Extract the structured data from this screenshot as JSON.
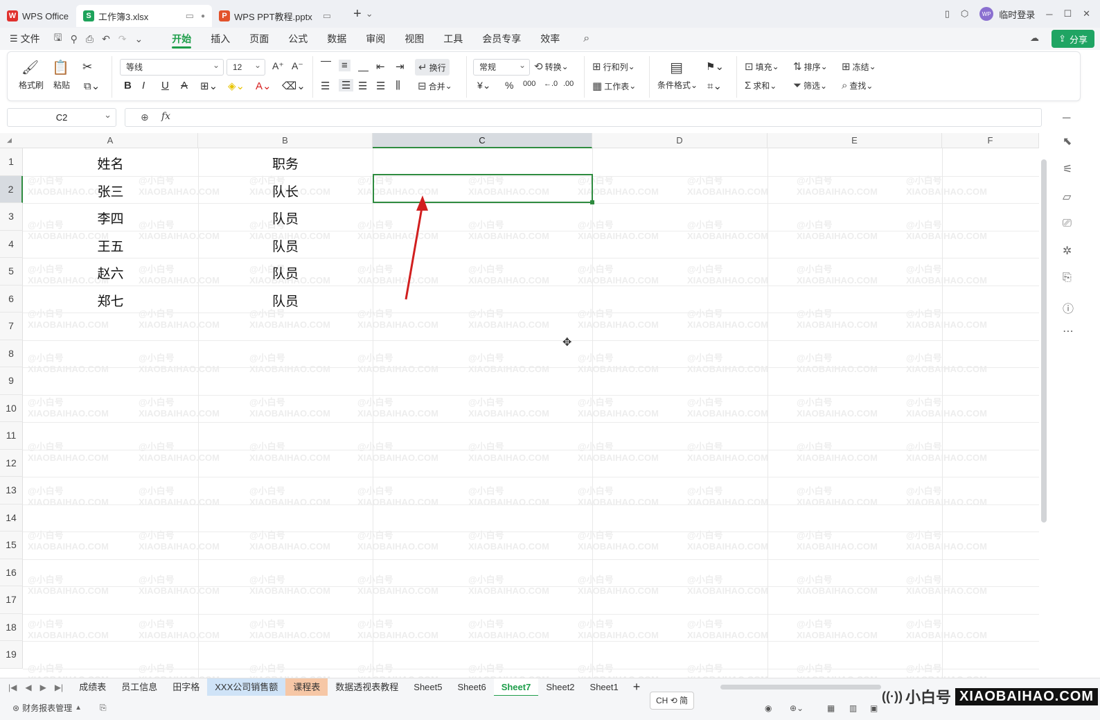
{
  "titlebar": {
    "tabs": [
      {
        "label": "WPS Office",
        "logo": "W",
        "color": "#e0312e"
      },
      {
        "label": "工作簿3.xlsx",
        "logo": "S",
        "color": "#1ea35b"
      },
      {
        "label": "WPS PPT教程.pptx",
        "logo": "P",
        "color": "#e2522b"
      }
    ],
    "login": "临时登录",
    "avatar": "WP"
  },
  "menubar": {
    "file": "文件",
    "items": [
      "开始",
      "插入",
      "页面",
      "公式",
      "数据",
      "审阅",
      "视图",
      "工具",
      "会员专享",
      "效率"
    ],
    "active": "开始",
    "share": "分享"
  },
  "ribbon": {
    "format_painter": "格式刷",
    "paste": "粘贴",
    "font": "等线",
    "size": "12",
    "wrap": "换行",
    "merge": "合并",
    "number_format": "常规",
    "convert": "转换",
    "rows_cols": "行和列",
    "worksheet": "工作表",
    "cond_format": "条件格式",
    "fill": "填充",
    "sort": "排序",
    "freeze": "冻结",
    "sum": "求和",
    "filter": "筛选",
    "find": "查找"
  },
  "formula": {
    "namebox": "C2",
    "fx": "fx",
    "value": ""
  },
  "columns": [
    "A",
    "B",
    "C",
    "D",
    "E",
    "F"
  ],
  "rows": [
    "1",
    "2",
    "3",
    "4",
    "5",
    "6",
    "7",
    "8",
    "9",
    "10",
    "11",
    "12",
    "13",
    "14",
    "15",
    "16",
    "17",
    "18",
    "19"
  ],
  "cells": {
    "A": [
      "姓名",
      "张三",
      "李四",
      "王五",
      "赵六",
      "郑七"
    ],
    "B": [
      "职务",
      "队长",
      "队员",
      "队员",
      "队员",
      "队员"
    ]
  },
  "watermark": {
    "line1": "@小白号",
    "line2": "XIAOBAIHAO.COM"
  },
  "sheets": [
    "成绩表",
    "员工信息",
    "田字格",
    "XXX公司销售额",
    "课程表",
    "数据透视表教程",
    "Sheet5",
    "Sheet6",
    "Sheet7",
    "Sheet2",
    "Sheet1"
  ],
  "active_sheet": "Sheet7",
  "status": {
    "macro": "财务报表管理",
    "ime": "CH ⟲ 简"
  },
  "brand": {
    "name": "小白号",
    "site": "XIAOBAIHAO.COM"
  }
}
